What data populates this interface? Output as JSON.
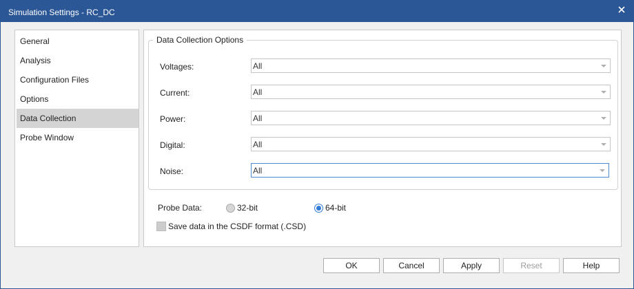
{
  "window": {
    "title": "Simulation Settings - RC_DC",
    "close_glyph": "×",
    "titlebar_color": "#2b5797"
  },
  "nav": {
    "items": [
      {
        "label": "General",
        "selected": false
      },
      {
        "label": "Analysis",
        "selected": false
      },
      {
        "label": "Configuration Files",
        "selected": false
      },
      {
        "label": "Options",
        "selected": false
      },
      {
        "label": "Data Collection",
        "selected": true
      },
      {
        "label": "Probe Window",
        "selected": false
      }
    ]
  },
  "data_collection": {
    "group_title": "Data Collection Options",
    "fields": [
      {
        "label": "Voltages:",
        "value": "All"
      },
      {
        "label": "Current:",
        "value": "All"
      },
      {
        "label": "Power:",
        "value": "All"
      },
      {
        "label": "Digital:",
        "value": "All"
      },
      {
        "label": "Noise:",
        "value": "All",
        "focused": true
      }
    ],
    "probe_data": {
      "label": "Probe Data:",
      "options": [
        {
          "label": "32-bit",
          "checked": false
        },
        {
          "label": "64-bit",
          "checked": true
        }
      ]
    },
    "csdf": {
      "label": "Save data in the CSDF format (.CSD)",
      "checked": false
    }
  },
  "buttons": {
    "ok": "OK",
    "cancel": "Cancel",
    "apply": "Apply",
    "reset": "Reset",
    "help": "Help"
  },
  "colors": {
    "accent": "#2e7bd6",
    "selected_nav": "#d4d4d4"
  }
}
